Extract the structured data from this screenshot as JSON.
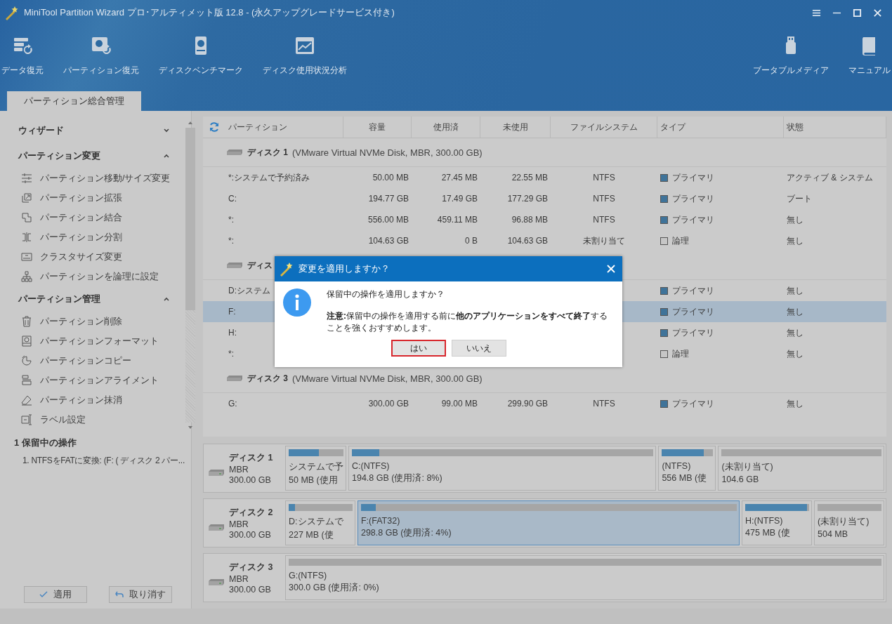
{
  "window": {
    "title": "MiniTool Partition Wizard プロ･アルティメット版 12.8 - (永久アップグレードサービス付き)"
  },
  "toolbar": [
    {
      "label": "データ復元"
    },
    {
      "label": "パーティション復元"
    },
    {
      "label": "ディスクベンチマーク"
    },
    {
      "label": "ディスク使用状況分析"
    }
  ],
  "toolbar_right": [
    {
      "label": "ブータブルメディア"
    },
    {
      "label": "マニュアル"
    }
  ],
  "tabs": [
    {
      "label": "パーティション総合管理",
      "selected": true
    }
  ],
  "sidebar": {
    "sections": [
      {
        "title": "ウィザード",
        "expanded": false
      },
      {
        "title": "パーティション変更",
        "expanded": true,
        "items": [
          "パーティション移動/サイズ変更",
          "パーティション拡張",
          "パーティション結合",
          "パーティション分割",
          "クラスタサイズ変更",
          "パーティションを論理に設定"
        ]
      },
      {
        "title": "パーティション管理",
        "expanded": true,
        "items": [
          "パーティション削除",
          "パーティションフォーマット",
          "パーティションコピー",
          "パーティションアライメント",
          "パーティション抹消",
          "ラベル設定"
        ]
      }
    ]
  },
  "pending": {
    "title": "1 保留中の操作",
    "items": [
      "1. NTFSをFATに変換: (F: ( ディスク 2 パー..."
    ]
  },
  "actions": [
    {
      "label": "適用",
      "kind": "apply"
    },
    {
      "label": "取り消す",
      "kind": "undo"
    }
  ],
  "table": {
    "columns": [
      "パーティション",
      "容量",
      "使用済",
      "未使用",
      "ファイルシステム",
      "タイプ",
      "状態"
    ],
    "disks": [
      {
        "name": "ディスク 1",
        "detail": "(VMware Virtual NVMe Disk, MBR, 300.00 GB)",
        "rows": [
          {
            "partition": "*:システムで予約済み",
            "capacity": "50.00 MB",
            "used": "27.45 MB",
            "unused": "22.55 MB",
            "fs": "NTFS",
            "type": "プライマリ",
            "color": "#3f7399",
            "status": "アクティブ & システム",
            "selected": false
          },
          {
            "partition": "C:",
            "capacity": "194.77 GB",
            "used": "17.49 GB",
            "unused": "177.29 GB",
            "fs": "NTFS",
            "type": "プライマリ",
            "color": "#3f7399",
            "status": "ブート",
            "selected": false
          },
          {
            "partition": "*:",
            "capacity": "556.00 MB",
            "used": "459.11 MB",
            "unused": "96.88 MB",
            "fs": "NTFS",
            "type": "プライマリ",
            "color": "#3f7399",
            "status": "無し",
            "selected": false
          },
          {
            "partition": "*:",
            "capacity": "104.63 GB",
            "used": "0 B",
            "unused": "104.63 GB",
            "fs": "未割り当て",
            "type": "論理",
            "color": "#c6c6c6",
            "status": "無し",
            "selected": false
          }
        ]
      },
      {
        "name": "ディス",
        "rows": [
          {
            "partition": "D:システム",
            "type": "プライマリ",
            "color": "#3f7399",
            "status": "無し",
            "selected": false
          },
          {
            "partition": "F:",
            "type": "プライマリ",
            "color": "#3f7399",
            "status": "無し",
            "selected": true
          },
          {
            "partition": "H:",
            "type": "プライマリ",
            "color": "#3f7399",
            "status": "無し",
            "selected": false
          },
          {
            "partition": "*:",
            "type": "論理",
            "color": "#c6c6c6",
            "status": "無し",
            "selected": false
          }
        ]
      },
      {
        "name": "ディスク 3",
        "detail": "(VMware Virtual NVMe Disk, MBR, 300.00 GB)",
        "rows": [
          {
            "partition": "G:",
            "capacity": "300.00 GB",
            "used": "99.00 MB",
            "unused": "299.90 GB",
            "fs": "NTFS",
            "type": "プライマリ",
            "color": "#3f7399",
            "status": "無し",
            "selected": false
          }
        ]
      }
    ]
  },
  "disk_map": [
    {
      "name": "ディスク 1",
      "scheme": "MBR",
      "size": "300.00 GB",
      "partitions": [
        {
          "label": "システムで予",
          "info": "50 MB (使用",
          "level": 0.55,
          "selected": false
        },
        {
          "label": "C:(NTFS)",
          "info": "194.8 GB (使用済: 8%)",
          "level": 0.09,
          "selected": false
        },
        {
          "label": "(NTFS)",
          "info": "556 MB (使",
          "level": 0.82,
          "selected": false
        },
        {
          "label": "(未割り当て)",
          "info": "104.6 GB",
          "selected": false
        }
      ]
    },
    {
      "name": "ディスク 2",
      "scheme": "MBR",
      "size": "300.00 GB",
      "partitions": [
        {
          "label": "D:システムで",
          "info": "227 MB (使",
          "level": 0.1,
          "selected": false
        },
        {
          "label": "F:(FAT32)",
          "info": "298.8 GB (使用済: 4%)",
          "level": 0.04,
          "selected": true
        },
        {
          "label": "H:(NTFS)",
          "info": "475 MB (使",
          "level": 0.97,
          "selected": false
        },
        {
          "label": "(未割り当て)",
          "info": "504 MB",
          "selected": false
        }
      ]
    },
    {
      "name": "ディスク 3",
      "scheme": "MBR",
      "size": "300.00 GB",
      "partitions": [
        {
          "label": "G:(NTFS)",
          "info": "300.0 GB (使用済: 0%)",
          "selected": false
        }
      ]
    }
  ],
  "dialog": {
    "title": "変更を適用しますか？",
    "message": "保留中の操作を適用しますか？",
    "note": "**注意:**保留中の操作を適用する前に**他のアプリケーションをすべて終了**することを強くおすすめします。",
    "buttons": [
      {
        "label": "はい",
        "focused": true
      },
      {
        "label": "いいえ",
        "focused": false
      }
    ]
  }
}
